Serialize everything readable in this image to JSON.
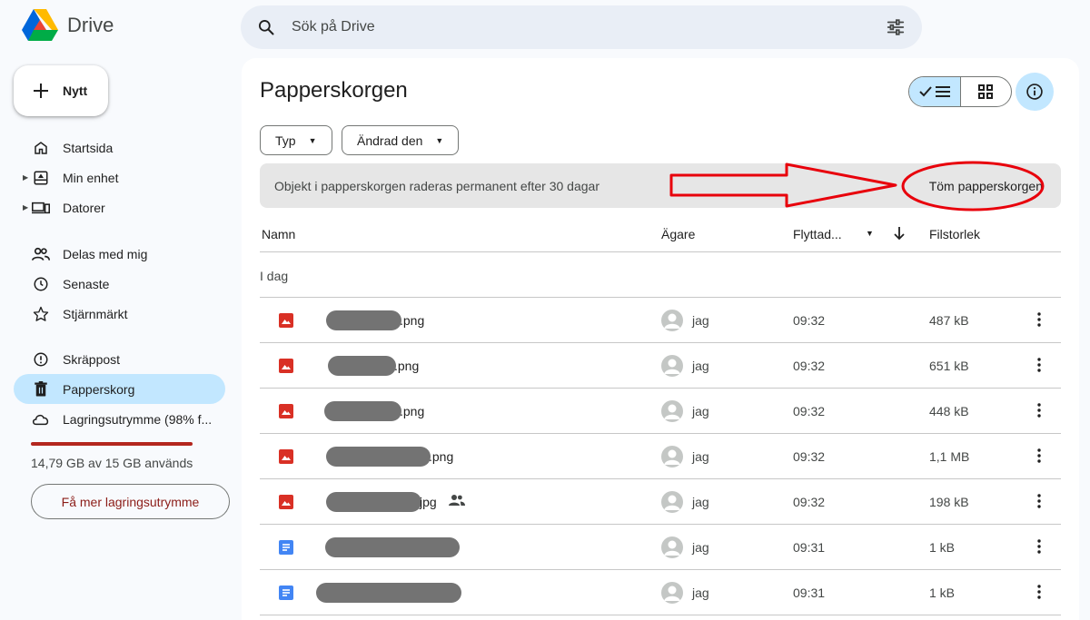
{
  "app": {
    "name": "Drive"
  },
  "search": {
    "placeholder": "Sök på Drive"
  },
  "sidebar": {
    "new_label": "Nytt",
    "items": [
      {
        "label": "Startsida",
        "icon": "home-icon"
      },
      {
        "label": "Min enhet",
        "icon": "my-drive-icon"
      },
      {
        "label": "Datorer",
        "icon": "computer-icon"
      },
      {
        "label": "Delas med mig",
        "icon": "people-icon"
      },
      {
        "label": "Senaste",
        "icon": "clock-icon"
      },
      {
        "label": "Stjärnmärkt",
        "icon": "star-icon"
      },
      {
        "label": "Skräppost",
        "icon": "spam-icon"
      },
      {
        "label": "Papperskorg",
        "icon": "trash-icon",
        "active": true
      },
      {
        "label": "Lagringsutrymme (98% f...",
        "icon": "cloud-icon"
      }
    ],
    "storage_used_fraction": 0.98,
    "storage_text": "14,79 GB av 15 GB används",
    "more_storage_label": "Få mer lagringsutrymme"
  },
  "main": {
    "title": "Papperskorgen",
    "filters": [
      "Typ",
      "Ändrad den"
    ],
    "banner_text": "Objekt i papperskorgen raderas permanent efter 30 dagar",
    "empty_trash_label": "Töm papperskorgen",
    "columns": {
      "name": "Namn",
      "owner": "Ägare",
      "moved": "Flyttad...",
      "size": "Filstorlek"
    },
    "group_label": "I dag",
    "rows": [
      {
        "type": "image",
        "suffix": ".png",
        "owner": "jag",
        "time": "09:32",
        "size": "487 kB"
      },
      {
        "type": "image",
        "suffix": ".png",
        "owner": "jag",
        "time": "09:32",
        "size": "651 kB"
      },
      {
        "type": "image",
        "suffix": ".png",
        "owner": "jag",
        "time": "09:32",
        "size": "448 kB"
      },
      {
        "type": "image",
        "suffix": ".png",
        "owner": "jag",
        "time": "09:32",
        "size": "1,1 MB"
      },
      {
        "type": "image",
        "suffix": "jpg",
        "owner": "jag",
        "time": "09:32",
        "size": "198 kB",
        "shared": true
      },
      {
        "type": "doc",
        "suffix": "",
        "owner": "jag",
        "time": "09:31",
        "size": "1 kB"
      },
      {
        "type": "doc",
        "suffix": "",
        "owner": "jag",
        "time": "09:31",
        "size": "1 kB"
      }
    ]
  },
  "colors": {
    "accent": "#c2e7ff",
    "image_icon": "#d93025",
    "doc_icon": "#4285f4",
    "annotation": "#e8000b",
    "storage_bar": "#b3261e"
  }
}
